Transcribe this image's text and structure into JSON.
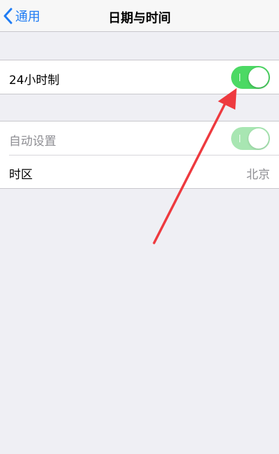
{
  "navbar": {
    "back_label": "通用",
    "title": "日期与时间"
  },
  "settings": {
    "group1": {
      "rows": [
        {
          "label": "24小时制",
          "toggle_on": true,
          "enabled": true
        }
      ]
    },
    "group2": {
      "rows": [
        {
          "label": "自动设置",
          "toggle_on": true,
          "enabled": false
        },
        {
          "label": "时区",
          "value": "北京"
        }
      ]
    }
  },
  "colors": {
    "accent": "#1f7cf4",
    "toggle_on": "#4cd964",
    "toggle_disabled": "#a8e6b2",
    "annotation_arrow": "#ee3a3f",
    "background": "#efeff4"
  },
  "icons": [
    "chevron-left-icon"
  ]
}
